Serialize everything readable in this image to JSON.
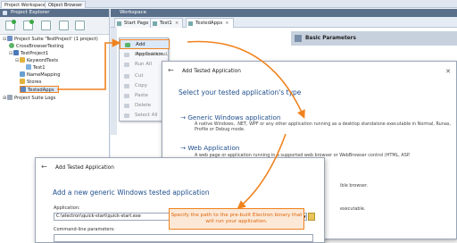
{
  "top_tabs": [
    "Project Workspace",
    "Object Browser"
  ],
  "explorer": {
    "title": "Project Explorer",
    "tree": [
      {
        "label": "Project Suite 'TestProject' (1 project)"
      },
      {
        "label": "CrossBrowserTesting"
      },
      {
        "label": "TestProject1"
      },
      {
        "label": "KeywordTests"
      },
      {
        "label": "Test1"
      },
      {
        "label": "NameMapping"
      },
      {
        "label": "Stores"
      },
      {
        "label": "TestedApps"
      },
      {
        "label": "Project Suite Logs"
      }
    ]
  },
  "workspace": {
    "title": "Workspace",
    "tabs": [
      {
        "label": "Start Page"
      },
      {
        "label": "Test1"
      },
      {
        "label": "TestedApps"
      }
    ],
    "basic_params": "Basic Parameters"
  },
  "context_menu": [
    "Add Application...",
    "Run Selected",
    "Run All",
    "Cut",
    "Copy",
    "Paste",
    "Delete",
    "Select All"
  ],
  "dialog1": {
    "title": "Add Tested Application",
    "heading": "Select your tested application's type",
    "option1_title": "Generic Windows application",
    "option1_desc": "A native Windows, .NET, WPF or any other application running as a desktop standalone executable in Normal, Runas, Profile or Debug mode.",
    "option2_title": "Web Application",
    "option2_desc_partial": "A web page or application running in a supported web browser or WebBrowser control (HTML, ASP.",
    "frag1": "ible browser.",
    "frag2": "executable."
  },
  "dialog2": {
    "title": "Add Tested Application",
    "heading": "Add a new generic Windows tested application",
    "app_label": "Application:",
    "app_value": "C:\\electron\\quick-start\\quick-start.exe",
    "cmd_label": "Command-line parameters:"
  },
  "callout": "Specify the path to the pre-built Electron binary that will run your application.",
  "colors": {
    "accent": "#f0821e",
    "title_blue": "#1f4e8c",
    "panel_header": "#5a6f8a"
  }
}
